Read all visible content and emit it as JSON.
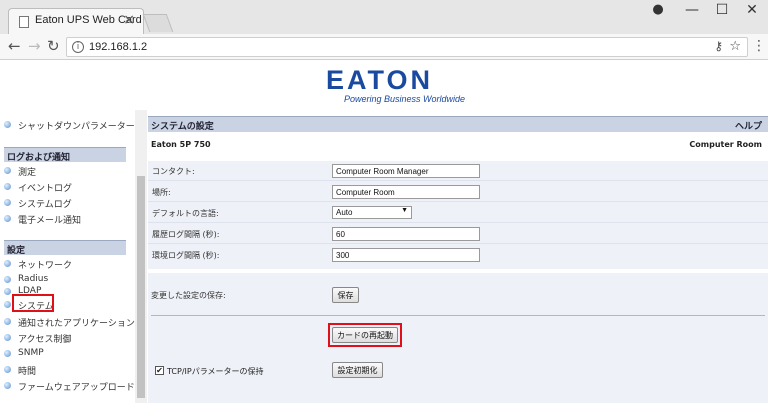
{
  "browser": {
    "tab_title": "Eaton UPS Web Card",
    "tab_close": "×",
    "url": "192.168.1.2",
    "window_controls": {
      "user": "●",
      "minimize": "—",
      "maximize": "☐",
      "close": "✕"
    },
    "nav": {
      "back": "←",
      "forward": "→",
      "reload": "↻"
    },
    "icons": {
      "info": "i",
      "key": "⚷",
      "star": "☆",
      "menu": "⋮"
    }
  },
  "logo": {
    "word": "EATON",
    "tagline": "Powering Business Worldwide",
    "color": "#1a4aa0"
  },
  "sidebar": {
    "top_item": "シャットダウンパラメーター",
    "section_logs": "ログおよび通知",
    "log_items": [
      "測定",
      "イベントログ",
      "システムログ",
      "電子メール通知"
    ],
    "section_settings": "設定",
    "settings_items": [
      "ネットワーク",
      "Radius",
      "LDAP",
      "システム",
      "通知されたアプリケーション",
      "アクセス制御",
      "SNMP",
      "時間",
      "ファームウェアアップロード"
    ],
    "highlighted": "システム"
  },
  "content": {
    "title": "システムの設定",
    "help": "ヘルプ",
    "model": "Eaton 5P 750",
    "location_header": "Computer Room",
    "fields": {
      "contact_label": "コンタクト:",
      "contact_value": "Computer Room Manager",
      "location_label": "場所:",
      "location_value": "Computer Room",
      "language_label": "デフォルトの言語:",
      "language_value": "Auto",
      "history_label": "履歴ログ間隔 (秒):",
      "history_value": "60",
      "env_label": "環境ログ間隔 (秒):",
      "env_value": "300"
    },
    "save_label": "変更した設定の保存:",
    "save_button": "保存",
    "restart_button": "カードの再起動",
    "keep_tcpip_label": "TCP/IPパラメーターの保持",
    "keep_tcpip_checked": "✔",
    "reset_button": "設定初期化"
  },
  "highlight_color": "#e0101a"
}
